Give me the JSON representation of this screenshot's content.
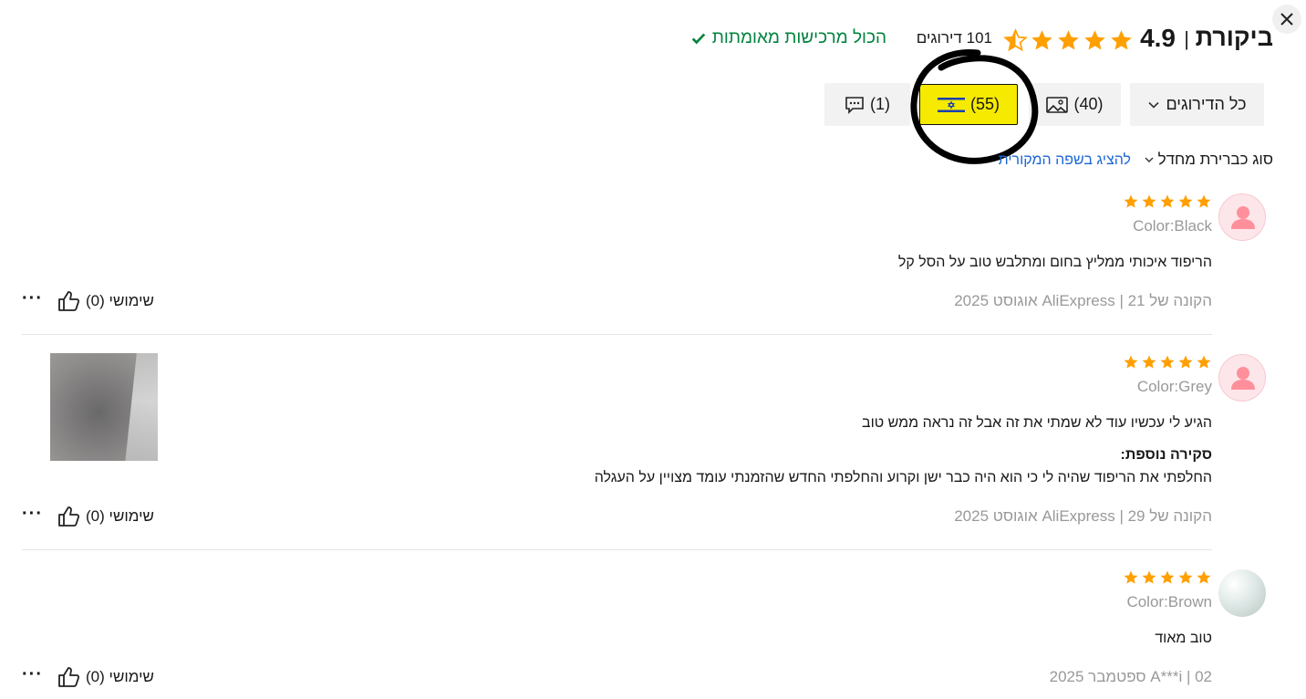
{
  "header": {
    "title": "ביקורת",
    "separator": "|",
    "score": "4.9",
    "stars_rating": 4.9,
    "ratings_count": "101 דירוגים",
    "verified_text": "הכול מרכישות מאומתות",
    "colors": {
      "star": "#ff9f00",
      "verified": "#00833e",
      "link": "#1a66d6",
      "highlight": "#f5ea00"
    }
  },
  "filters": {
    "all": "כל הדירוגים",
    "photos": "(40)",
    "country": "(55)",
    "comments": "(1)",
    "icons": [
      "chevron-down-icon",
      "image-icon",
      "israel-flag-icon",
      "comment-icon"
    ]
  },
  "sort": {
    "label": "סוג כברירת מחדל",
    "original_language_link": "להציג בשפה המקורית"
  },
  "reviews": [
    {
      "stars": 5,
      "sku": "Color:Black",
      "text": "הריפוד איכותי ממליץ בחום ומתלבש טוב על הסל קל",
      "meta": "הקונה של AliExpress | 21 אוגוסט 2025",
      "helpful": "שימושי (0)",
      "more": "···"
    },
    {
      "stars": 5,
      "sku": "Color:Grey",
      "text": "הגיע לי עכשיו עוד לא שמתי את זה אבל זה נראה ממש טוב",
      "additional_title": "סקירה נוספת:",
      "additional_text": "החלפתי את הריפוד שהיה לי כי הוא היה כבר ישן וקרוע והחלפתי החדש שהזמנתי עומד מצויין על העגלה",
      "meta": "הקונה של AliExpress | 29 אוגוסט 2025",
      "helpful": "שימושי (0)",
      "more": "···"
    },
    {
      "stars": 5,
      "sku": "Color:Brown",
      "text": "טוב מאוד",
      "meta": "A***i | 02 ספטמבר 2025",
      "helpful": "שימושי (0)",
      "more": "···"
    }
  ]
}
